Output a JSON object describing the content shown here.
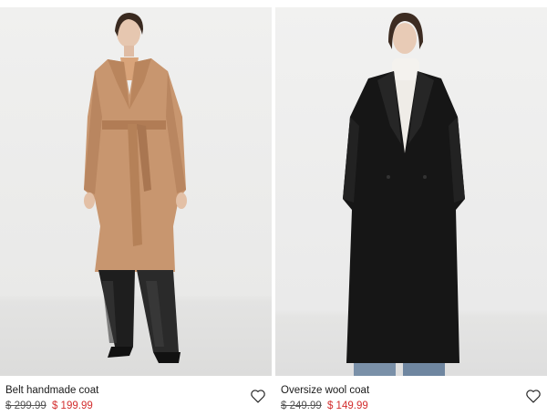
{
  "products": [
    {
      "name": "Belt handmade coat",
      "old_price": "$ 299.99",
      "new_price": "$ 199.99",
      "image": "model-in-camel-belted-coat",
      "favorite_icon": "heart-outline-icon"
    },
    {
      "name": "Oversize wool coat",
      "old_price": "$ 249.99",
      "new_price": "$ 149.99",
      "image": "model-in-black-oversize-coat",
      "favorite_icon": "heart-outline-icon"
    }
  ],
  "colors": {
    "sale_price": "#d32f2f",
    "photo_background": "#ededed",
    "camel_coat": "#c8966f",
    "black_coat": "#161616"
  }
}
